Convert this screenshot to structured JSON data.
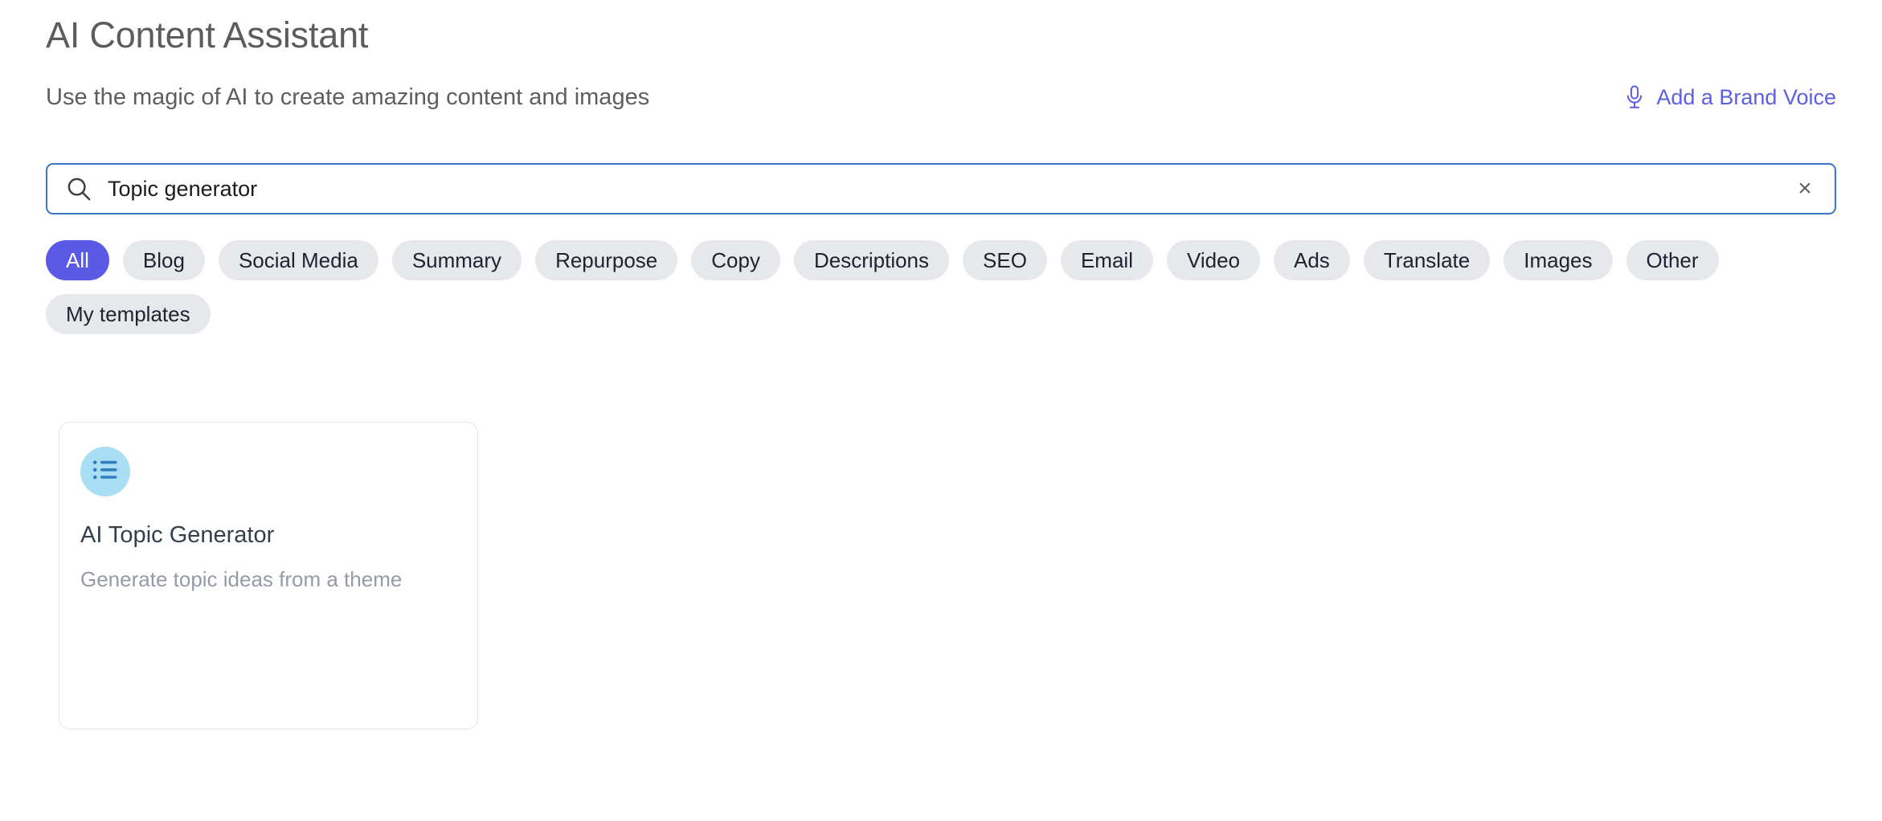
{
  "header": {
    "title": "AI Content Assistant",
    "subtitle": "Use the magic of AI to create amazing content and images",
    "brand_voice_label": "Add a Brand Voice",
    "brand_voice_icon": "microphone-icon",
    "brand_voice_color": "#5d5fe3"
  },
  "search": {
    "value": "Topic generator",
    "placeholder": "Search",
    "icon": "search-icon",
    "clear_icon": "close-icon",
    "clear_glyph": "×",
    "focus_border_color": "#3b76c4"
  },
  "filters": {
    "active_color": "#5a5ae6",
    "inactive_color": "#e6e8eb",
    "chips": [
      {
        "label": "All",
        "active": true
      },
      {
        "label": "Blog",
        "active": false
      },
      {
        "label": "Social Media",
        "active": false
      },
      {
        "label": "Summary",
        "active": false
      },
      {
        "label": "Repurpose",
        "active": false
      },
      {
        "label": "Copy",
        "active": false
      },
      {
        "label": "Descriptions",
        "active": false
      },
      {
        "label": "SEO",
        "active": false
      },
      {
        "label": "Email",
        "active": false
      },
      {
        "label": "Video",
        "active": false
      },
      {
        "label": "Ads",
        "active": false
      },
      {
        "label": "Translate",
        "active": false
      },
      {
        "label": "Images",
        "active": false
      },
      {
        "label": "Other",
        "active": false
      },
      {
        "label": "My templates",
        "active": false
      }
    ]
  },
  "results": {
    "cards": [
      {
        "title": "AI Topic Generator",
        "description": "Generate topic ideas from a theme",
        "icon": "list-icon",
        "icon_bg_color": "#aadef5",
        "icon_color": "#2f7fc0"
      }
    ]
  }
}
